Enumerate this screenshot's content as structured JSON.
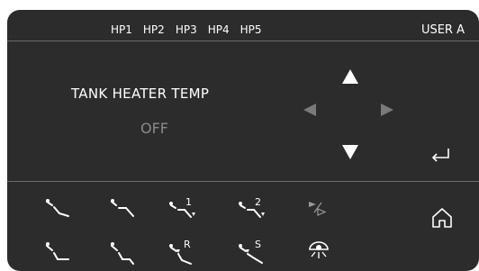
{
  "header": {
    "tabs": [
      {
        "label": "HP1"
      },
      {
        "label": "HP2"
      },
      {
        "label": "HP3"
      },
      {
        "label": "HP4"
      },
      {
        "label": "HP5"
      }
    ],
    "user": "USER A"
  },
  "setting": {
    "title": "TANK HEATER TEMP",
    "value": "OFF"
  },
  "nav": {
    "icons": [
      "arrow-up-icon",
      "arrow-left-icon",
      "arrow-right-icon",
      "arrow-down-icon",
      "enter-icon"
    ]
  },
  "position_buttons": {
    "badge_1": "1",
    "badge_2": "2",
    "badge_r": "R",
    "badge_s": "S"
  },
  "colors": {
    "panel": "#2c2c2c",
    "text": "#ffffff",
    "dim_text": "#8a8a8a",
    "dim_arrow": "#7a7a7a",
    "divider": "#6a6a6a"
  }
}
